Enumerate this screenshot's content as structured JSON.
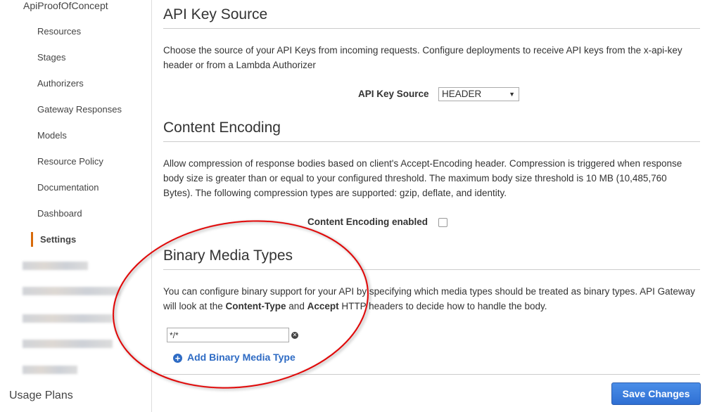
{
  "sidebar": {
    "api_name": "ApiProofOfConcept",
    "items": [
      {
        "label": "Resources"
      },
      {
        "label": "Stages"
      },
      {
        "label": "Authorizers"
      },
      {
        "label": "Gateway Responses"
      },
      {
        "label": "Models"
      },
      {
        "label": "Resource Policy"
      },
      {
        "label": "Documentation"
      },
      {
        "label": "Dashboard"
      },
      {
        "label": "Settings",
        "active": true
      }
    ],
    "usage_plans": "Usage Plans",
    "accent_color": "#d86b0b"
  },
  "api_key": {
    "title": "API Key Source",
    "description": "Choose the source of your API Keys from incoming requests. Configure deployments to receive API keys from the x-api-key header or from a Lambda Authorizer",
    "label": "API Key Source",
    "value": "HEADER"
  },
  "encoding": {
    "title": "Content Encoding",
    "description": "Allow compression of response bodies based on client's Accept-Encoding header. Compression is triggered when response body size is greater than or equal to your configured threshold. The maximum body size threshold is 10 MB (10,485,760 Bytes). The following compression types are supported: gzip, deflate, and identity.",
    "label": "Content Encoding enabled",
    "enabled": false
  },
  "binary": {
    "title": "Binary Media Types",
    "desc_1": "You can configure binary support for your API by specifying which media types should be treated as binary types. API Gateway will look at the ",
    "desc_b1": "Content-Type",
    "desc_2": " and ",
    "desc_b2": "Accept",
    "desc_3": " HTTP headers to decide how to handle the body.",
    "types": [
      "*/*"
    ],
    "add_label": "Add Binary Media Type"
  },
  "save_label": "Save Changes",
  "annotation_color": "#e00000"
}
